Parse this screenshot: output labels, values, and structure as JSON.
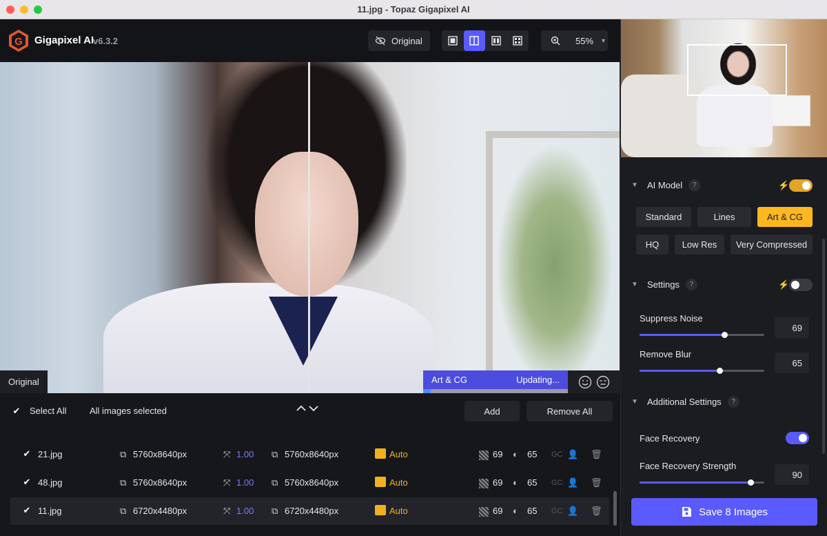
{
  "window": {
    "title": "11.jpg - Topaz Gigapixel AI"
  },
  "app": {
    "name": "Gigapixel AI",
    "version": "v6.3.2"
  },
  "toolbar": {
    "original_label": "Original",
    "view_modes": [
      "single-view",
      "split-view",
      "side-by-side-view",
      "grid-view"
    ],
    "active_view": "split-view",
    "zoom": "55%"
  },
  "preview": {
    "label": "Original",
    "model": "Art & CG",
    "status": "Updating...",
    "progress": 0.05
  },
  "list": {
    "select_all": "Select All",
    "status": "All images selected",
    "add_label": "Add",
    "remove_all_label": "Remove All",
    "rows": [
      {
        "name": "21.jpg",
        "input": "5760x8640px",
        "scale": "1.00",
        "output": "5760x8640px",
        "model": "Auto",
        "noise": "69",
        "blur": "65",
        "gc": "GC",
        "selected": false
      },
      {
        "name": "48.jpg",
        "input": "5760x8640px",
        "scale": "1.00",
        "output": "5760x8640px",
        "model": "Auto",
        "noise": "69",
        "blur": "65",
        "gc": "GC",
        "selected": false
      },
      {
        "name": "11.jpg",
        "input": "6720x4480px",
        "scale": "1.00",
        "output": "6720x4480px",
        "model": "Auto",
        "noise": "69",
        "blur": "65",
        "gc": "GC",
        "selected": true
      }
    ]
  },
  "panel": {
    "ai_model": {
      "title": "AI Model",
      "help": "?",
      "auto_enabled": true,
      "models": [
        "Standard",
        "Lines",
        "Art & CG",
        "HQ",
        "Low Res",
        "Very Compressed"
      ],
      "active": "Art & CG"
    },
    "settings": {
      "title": "Settings",
      "help": "?",
      "auto_enabled": false,
      "suppress_noise_label": "Suppress Noise",
      "suppress_noise": "69",
      "remove_blur_label": "Remove Blur",
      "remove_blur": "65"
    },
    "additional": {
      "title": "Additional Settings",
      "help": "?",
      "face_recovery_label": "Face Recovery",
      "face_recovery": true,
      "face_strength_label": "Face Recovery Strength",
      "face_strength": "90"
    },
    "save_label": "Save 8 Images"
  },
  "colors": {
    "accent": "#5a5aff",
    "model_active": "#fdb81f",
    "toggle_on": "#e0a52a"
  }
}
